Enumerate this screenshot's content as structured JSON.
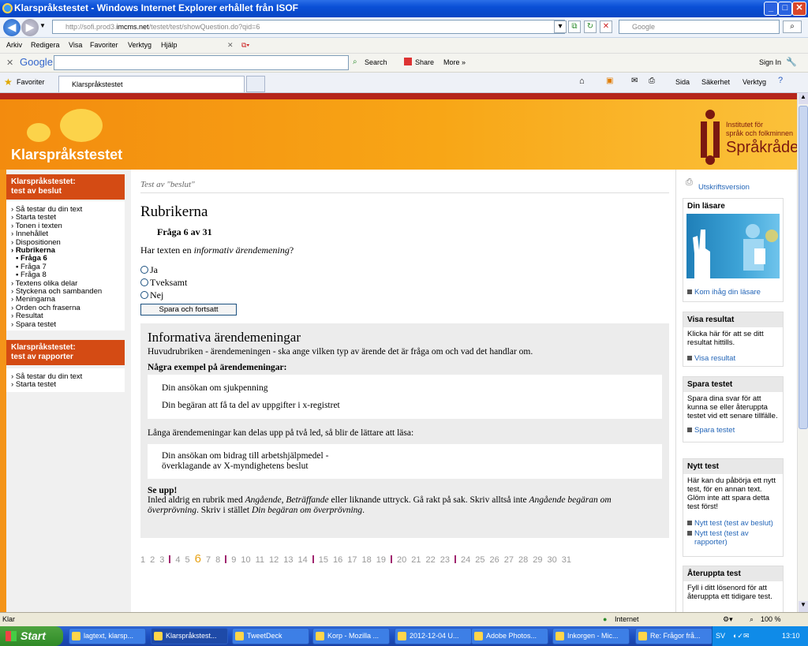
{
  "window": {
    "title": "Klarspråkstestet - Windows Internet Explorer erhållet från ISOF"
  },
  "address": {
    "url_prefix": "http://sofi.prod3.",
    "url_host": "imcms.net",
    "url_path": "/testet/test/showQuestion.do?qid=6",
    "search_placeholder": "Google"
  },
  "menu": [
    "Arkiv",
    "Redigera",
    "Visa",
    "Favoriter",
    "Verktyg",
    "Hjälp"
  ],
  "google_toolbar": {
    "logo": "Google",
    "search": "Search",
    "share": "Share",
    "more": "More »",
    "signin": "Sign In"
  },
  "favorites": {
    "label": "Favoriter",
    "tab": "Klarspråkstestet",
    "tools": [
      "Sida",
      "Säkerhet",
      "Verktyg"
    ]
  },
  "banner": {
    "brand": "Klarspråkstestet",
    "logo_line1": "Institutet för",
    "logo_line2": "språk och folkminnen",
    "logo_big": "Språkrådet"
  },
  "left": {
    "head1": "Klarspråkstestet:\ntest av beslut",
    "nav1": [
      {
        "label": "Så testar du din text",
        "type": "link"
      },
      {
        "label": "Starta testet",
        "type": "link"
      },
      {
        "label": "Tonen i texten",
        "type": "link"
      },
      {
        "label": "Innehållet",
        "type": "link"
      },
      {
        "label": "Dispositionen",
        "type": "link"
      },
      {
        "label": "Rubrikerna",
        "type": "bold"
      },
      {
        "label": "Fråga 6",
        "type": "subbold"
      },
      {
        "label": "Fråga 7",
        "type": "sub"
      },
      {
        "label": "Fråga 8",
        "type": "sub"
      },
      {
        "label": "Textens olika delar",
        "type": "link"
      },
      {
        "label": "Styckena och sambanden",
        "type": "link"
      },
      {
        "label": "Meningarna",
        "type": "link"
      },
      {
        "label": "Orden och fraserna",
        "type": "link"
      },
      {
        "label": "Resultat",
        "type": "link"
      },
      {
        "label": "Spara testet",
        "type": "link"
      }
    ],
    "head2": "Klarspråkstestet:\ntest av rapporter",
    "nav2": [
      "Så testar du din text",
      "Starta testet"
    ]
  },
  "main": {
    "crumb": "Test av \"beslut\"",
    "heading": "Rubrikerna",
    "question_no": "Fråga 6 av 31",
    "question_pre": "Har texten en ",
    "question_em": "informativ ärendemening",
    "question_post": "?",
    "options": [
      "Ja",
      "Tveksamt",
      "Nej"
    ],
    "submit": "Spara och fortsatt",
    "info_title": "Informativa ärendemeningar",
    "info_intro": "Huvudrubriken - ärendemeningen - ska ange vilken typ av ärende det är fråga om och vad det handlar om.",
    "examples_title": "Några exempel på ärendemeningar:",
    "example1": "Din ansökan om sjukpenning",
    "example2": "Din begäran att få ta del av uppgifter i x-registret",
    "long_text": "Långa ärendemeningar kan delas upp på två led, så blir de lättare att läsa:",
    "long_ex1": "Din ansökan om bidrag till arbetshjälpmedel -",
    "long_ex2": "överklagande av X-myndighetens beslut",
    "warn_title": "Se upp!",
    "warn_1": "Inled aldrig en rubrik med ",
    "warn_em1": "Angående",
    "warn_2": ", ",
    "warn_em2": "Beträffande",
    "warn_3": " eller liknande uttryck. Gå rakt på sak. Skriv alltså inte ",
    "warn_em3": "Angående begäran om överprövning",
    "warn_4": ". Skriv i stället ",
    "warn_em4": "Din begäran om överprövning",
    "warn_5": ".",
    "pages_a": [
      "1",
      "2",
      "3"
    ],
    "pages_b": [
      "4",
      "5",
      "6",
      "7",
      "8"
    ],
    "pages_c": [
      "9",
      "10",
      "11",
      "12",
      "13",
      "14"
    ],
    "pages_d": [
      "15",
      "16",
      "17",
      "18",
      "19"
    ],
    "pages_e": [
      "20",
      "21",
      "22",
      "23"
    ],
    "pages_f": [
      "24",
      "25",
      "26",
      "27",
      "28",
      "29",
      "30",
      "31"
    ],
    "current_page": "6"
  },
  "right": {
    "print": "Utskriftsversion",
    "box1_head": "Din läsare",
    "box1_link": "Kom ihåg din läsare",
    "box2_head": "Visa resultat",
    "box2_text": "Klicka här för att se ditt resultat hittills.",
    "box2_link": "Visa resultat",
    "box3_head": "Spara testet",
    "box3_text": "Spara dina svar för att kunna se eller återuppta testet vid ett senare tillfälle.",
    "box3_link": "Spara testet",
    "box4_head": "Nytt test",
    "box4_text": "Här kan du påbörja ett nytt test, för en annan text. Glöm inte att spara detta test först!",
    "box4_link1": "Nytt test (test av beslut)",
    "box4_link2": "Nytt test (test av rapporter)",
    "box5_head": "Återuppta test",
    "box5_text": "Fyll i ditt lösenord för att återuppta ett tidigare test."
  },
  "status": {
    "left": "Klar",
    "zone": "Internet",
    "zoom": "100 %"
  },
  "taskbar": {
    "start": "Start",
    "items": [
      "lagtext, klarsp...",
      "Klarspråkstest...",
      "TweetDeck",
      "Korp - Mozilla ...",
      "2012-12-04 U...",
      "Adobe Photos...",
      "Inkorgen - Mic...",
      "Re: Frågor frå..."
    ],
    "lang": "SV",
    "clock": "13:10"
  },
  "colors": {
    "orange": "#f49419",
    "red": "#b5251a",
    "link": "#2466b8",
    "logo": "#7b1810"
  }
}
